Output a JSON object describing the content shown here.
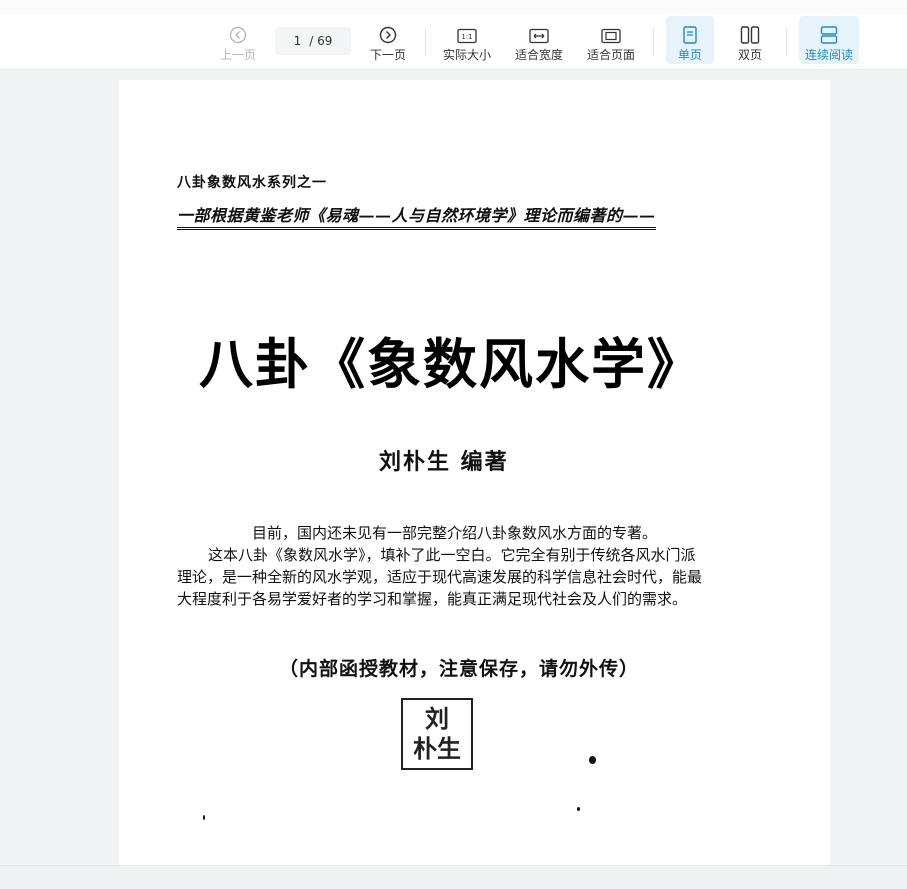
{
  "toolbar": {
    "prev_label": "上一页",
    "next_label": "下一页",
    "current_page": "1",
    "total_pages": "/ 69",
    "actual_size_label": "实际大小",
    "fit_width_label": "适合宽度",
    "fit_page_label": "适合页面",
    "single_page_label": "单页",
    "double_page_label": "双页",
    "continuous_label": "连续阅读",
    "accent_color": "#1a8ccc"
  },
  "document": {
    "series": "八卦象数风水系列之一",
    "subtitle": "一部根据黄鉴老师《易魂——人与自然环境学》理论而编著的——",
    "title": "八卦《象数风水学》",
    "author": "刘朴生 编著",
    "intro_lines": [
      "目前，国内还未见有一部完整介绍八卦象数风水方面的专著。",
      "这本八卦《象数风水学》，填补了此一空白。它完全有别于传统各风水门派",
      "理论，是一种全新的风水学观，适应于现代高速发展的科学信息社会时代，能最",
      "大程度利于各易学爱好者的学习和掌握，能真正满足现代社会及人们的需求。"
    ],
    "notice": "（内部函授教材，注意保存，请勿外传）",
    "seal_text": [
      "刘",
      "朴生"
    ]
  }
}
